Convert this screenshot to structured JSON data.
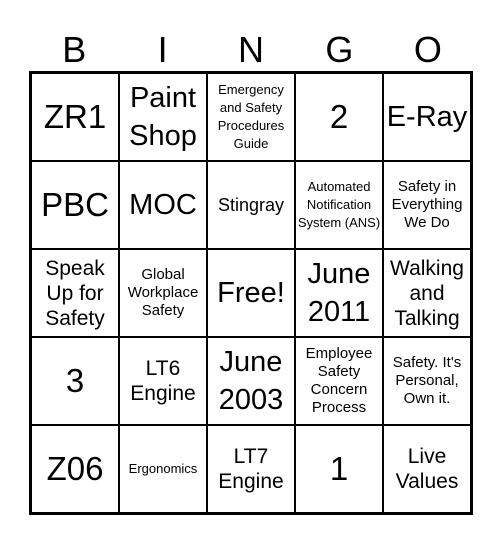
{
  "header": [
    "B",
    "I",
    "N",
    "G",
    "O"
  ],
  "cells": [
    {
      "text": "ZR1",
      "size": "s1"
    },
    {
      "text": "Paint Shop",
      "size": "s2"
    },
    {
      "text": "Emergency and Safety Procedures Guide",
      "size": "s6"
    },
    {
      "text": "2",
      "size": "s1"
    },
    {
      "text": "E-Ray",
      "size": "s2"
    },
    {
      "text": "PBC",
      "size": "s1"
    },
    {
      "text": "MOC",
      "size": "s2"
    },
    {
      "text": "Stingray",
      "size": "s4"
    },
    {
      "text": "Automated Notification System (ANS)",
      "size": "s6"
    },
    {
      "text": "Safety in Everything We Do",
      "size": "s5"
    },
    {
      "text": "Speak Up for Safety",
      "size": "s3"
    },
    {
      "text": "Global Workplace Safety",
      "size": "s5"
    },
    {
      "text": "Free!",
      "size": "s2"
    },
    {
      "text": "June 2011",
      "size": "s2"
    },
    {
      "text": "Walking and Talking",
      "size": "s3"
    },
    {
      "text": "3",
      "size": "s1"
    },
    {
      "text": "LT6 Engine",
      "size": "s3"
    },
    {
      "text": "June 2003",
      "size": "s2"
    },
    {
      "text": "Employee Safety Concern Process",
      "size": "s5"
    },
    {
      "text": "Safety. It's Personal, Own it.",
      "size": "s5"
    },
    {
      "text": "Z06",
      "size": "s1"
    },
    {
      "text": "Ergonomics",
      "size": "s6"
    },
    {
      "text": "LT7 Engine",
      "size": "s3"
    },
    {
      "text": "1",
      "size": "s1"
    },
    {
      "text": "Live Values",
      "size": "s3"
    }
  ]
}
